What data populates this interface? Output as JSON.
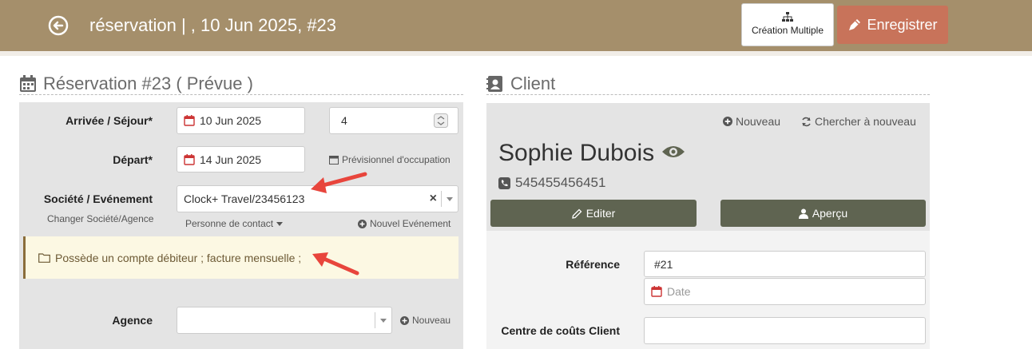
{
  "header": {
    "title": "réservation | , 10 Jun 2025, #23",
    "multi_label": "Création Multiple",
    "save_label": "Enregistrer"
  },
  "reservation": {
    "section_title": "Réservation #23 ( Prévue )",
    "arrival_label": "Arrivée / Séjour*",
    "arrival_date": "10 Jun 2025",
    "nights": "4",
    "departure_label": "Départ*",
    "departure_date": "14 Jun 2025",
    "forecast_link": "Prévisionnel d'occupation",
    "company_label": "Société / Evénement",
    "change_company": "Changer Société/Agence",
    "company_value": "Clock+ Travel/23456123",
    "clear_symbol": "×",
    "contact_person": "Personne de contact",
    "new_event": "Nouvel Evénement",
    "alert_text": "Possède un compte débiteur ; facture mensuelle ;",
    "agency_label": "Agence",
    "agency_value": "",
    "agency_new": "Nouveau"
  },
  "client": {
    "section_title": "Client",
    "new_link": "Nouveau",
    "search_again": "Chercher à nouveau",
    "name": "Sophie Dubois",
    "phone": "545455456451",
    "edit_label": "Editer",
    "preview_label": "Aperçu",
    "reference_label": "Référence",
    "reference_value": "#21",
    "date_placeholder": "Date",
    "cost_center_label": "Centre de coûts Client",
    "cost_center_value": ""
  },
  "colors": {
    "topbar": "#a58f6b",
    "save_button": "#c8735a",
    "dark_button": "#5f6451",
    "panel": "#e4e4e4",
    "alert_bg": "#fcf8e3",
    "annotation_arrow": "#e8453c"
  }
}
